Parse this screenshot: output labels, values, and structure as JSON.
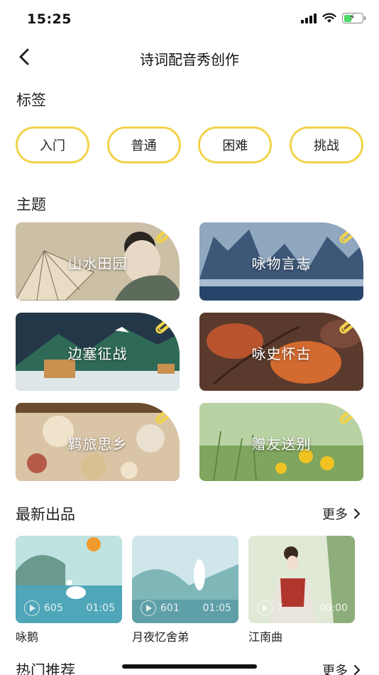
{
  "status": {
    "time": "15:25"
  },
  "nav": {
    "title": "诗词配音秀创作"
  },
  "sections": {
    "tags_title": "标签",
    "themes_title": "主题",
    "latest_title": "最新出品",
    "hot_title": "热门推荐",
    "more": "更多"
  },
  "tags": [
    "入门",
    "普通",
    "困难",
    "挑战"
  ],
  "themes": [
    "山水田园",
    "咏物言志",
    "边塞征战",
    "咏史怀古",
    "羁旅思乡",
    "赠友送别"
  ],
  "products": [
    {
      "name": "咏鹅",
      "plays": "605",
      "duration": "01:05"
    },
    {
      "name": "月夜忆舍弟",
      "plays": "601",
      "duration": "01:05"
    },
    {
      "name": "江南曲",
      "plays": "7",
      "duration": "00:00"
    }
  ],
  "colors": {
    "accent": "#f2d34a"
  }
}
